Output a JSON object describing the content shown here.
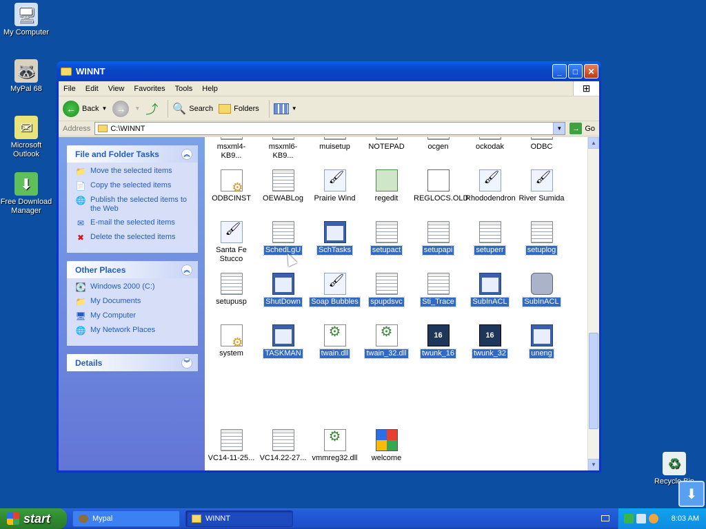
{
  "desktop": {
    "icons": [
      {
        "label": "My Computer",
        "glyph": "🖥"
      },
      {
        "label": "MyPal 68",
        "glyph": "🦝"
      },
      {
        "label": "Microsoft Outlook",
        "glyph": "✉"
      },
      {
        "label": "Free Download Manager",
        "glyph": "⬇"
      }
    ],
    "recycle_bin": "Recycle Bin"
  },
  "window": {
    "title": "WINNT",
    "menu": [
      "File",
      "Edit",
      "View",
      "Favorites",
      "Tools",
      "Help"
    ],
    "toolbar": {
      "back": "Back",
      "search": "Search",
      "folders": "Folders"
    },
    "address": {
      "label": "Address",
      "value": "C:\\WINNT",
      "go": "Go"
    }
  },
  "taskpane": {
    "file_tasks": {
      "title": "File and Folder Tasks",
      "items": [
        "Move the selected items",
        "Copy the selected items",
        "Publish the selected items to the Web",
        "E-mail the selected items",
        "Delete the selected items"
      ]
    },
    "other_places": {
      "title": "Other Places",
      "items": [
        "Windows 2000 (C:)",
        "My Documents",
        "My Computer",
        "My Network Places"
      ]
    },
    "details": {
      "title": "Details"
    }
  },
  "files": [
    {
      "name": "msxml4-KB9...",
      "icon": "doc",
      "selected": false
    },
    {
      "name": "msxml6-KB9...",
      "icon": "doc",
      "selected": false
    },
    {
      "name": "muisetup",
      "icon": "doc",
      "selected": false
    },
    {
      "name": "NOTEPAD",
      "icon": "doc",
      "selected": false
    },
    {
      "name": "ocgen",
      "icon": "doc",
      "selected": false
    },
    {
      "name": "ockodak",
      "icon": "doc",
      "selected": false
    },
    {
      "name": "ODBC",
      "icon": "doc",
      "selected": false
    },
    {
      "name": "ODBCINST",
      "icon": "cfg",
      "selected": false
    },
    {
      "name": "OEWABLog",
      "icon": "doc",
      "selected": false
    },
    {
      "name": "Prairie Wind",
      "icon": "brush",
      "selected": false
    },
    {
      "name": "regedit",
      "icon": "cube",
      "selected": false
    },
    {
      "name": "REGLOCS.OLD",
      "icon": "txt",
      "selected": false
    },
    {
      "name": "Rhododendron",
      "icon": "brush",
      "selected": false
    },
    {
      "name": "River Sumida",
      "icon": "brush",
      "selected": false
    },
    {
      "name": "Santa Fe Stucco",
      "icon": "brush",
      "selected": false
    },
    {
      "name": "SchedLgU",
      "icon": "doc",
      "selected": true
    },
    {
      "name": "SchTasks",
      "icon": "app",
      "selected": true
    },
    {
      "name": "setupact",
      "icon": "doc",
      "selected": true
    },
    {
      "name": "setupapi",
      "icon": "doc",
      "selected": true
    },
    {
      "name": "setuperr",
      "icon": "doc",
      "selected": true
    },
    {
      "name": "setuplog",
      "icon": "doc",
      "selected": true
    },
    {
      "name": "setupusp",
      "icon": "doc",
      "selected": false
    },
    {
      "name": "ShutDown",
      "icon": "app",
      "selected": true
    },
    {
      "name": "Soap Bubbles",
      "icon": "brush",
      "selected": true
    },
    {
      "name": "spupdsvc",
      "icon": "doc",
      "selected": true
    },
    {
      "name": "Sti_Trace",
      "icon": "doc",
      "selected": true
    },
    {
      "name": "SubInACL",
      "icon": "app",
      "selected": true
    },
    {
      "name": "SubInACL",
      "icon": "acl",
      "selected": true
    },
    {
      "name": "system",
      "icon": "cfg",
      "selected": false
    },
    {
      "name": "TASKMAN",
      "icon": "app",
      "selected": true
    },
    {
      "name": "twain.dll",
      "icon": "dll",
      "selected": true
    },
    {
      "name": "twain_32.dll",
      "icon": "dll",
      "selected": true
    },
    {
      "name": "twunk_16",
      "icon": "16",
      "selected": true
    },
    {
      "name": "twunk_32",
      "icon": "16",
      "selected": true
    },
    {
      "name": "uneng",
      "icon": "app",
      "selected": true
    },
    {
      "name": "VC14-11-25...",
      "icon": "doc",
      "selected": false
    },
    {
      "name": "VC14.22-27...",
      "icon": "doc",
      "selected": false
    },
    {
      "name": "vmmreg32.dll",
      "icon": "dll",
      "selected": false
    },
    {
      "name": "welcome",
      "icon": "flag",
      "selected": false
    }
  ],
  "taskbar": {
    "start": "start",
    "tasks": [
      {
        "label": "Mypal",
        "active": false
      },
      {
        "label": "WINNT",
        "active": true
      }
    ],
    "time": "8:03 AM"
  }
}
